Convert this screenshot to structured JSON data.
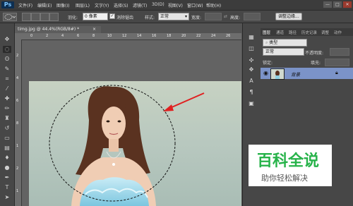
{
  "app": {
    "logo": "Ps"
  },
  "menu": [
    "文件(F)",
    "编辑(E)",
    "图像(I)",
    "图层(L)",
    "文字(Y)",
    "选择(S)",
    "滤镜(T)",
    "3D(D)",
    "视图(V)",
    "窗口(W)",
    "帮助(H)"
  ],
  "window_controls": {
    "minimize": "—",
    "maximize": "□",
    "close": "✕"
  },
  "options": {
    "feather_label": "羽化:",
    "feather_value": "0 像素",
    "antialias_label": "消除锯齿",
    "antialias_checked": "✓",
    "style_label": "样式:",
    "style_value": "正常",
    "width_label": "宽度:",
    "height_label": "高度:",
    "refine_button": "调整边缘..."
  },
  "document": {
    "tab_title": "timg.jpg @ 44.4%(RGB/8#) *",
    "tab_close": "×"
  },
  "ruler_numbers": [
    "0",
    "2",
    "4",
    "6",
    "8",
    "10",
    "12",
    "14",
    "16",
    "18",
    "20",
    "22",
    "24",
    "26"
  ],
  "ruler_left_numbers": [
    "2",
    "4",
    "6",
    "8",
    "1",
    "2",
    "1"
  ],
  "panel": {
    "tabs": [
      "图层",
      "通道",
      "路径",
      "历史记录",
      "调整",
      "动作"
    ],
    "filter_label": "类型",
    "blend_mode": "正常",
    "opacity_label": "不透明度:",
    "lock_label": "锁定:",
    "fill_label": "填充:",
    "layer_name": "背景"
  },
  "watermark": {
    "title": "百科全说",
    "subtitle": "助你轻松解决"
  },
  "colors": {
    "accent_layer": "#7b93c8",
    "watermark_green": "#27b34a",
    "arrow_red": "#e02020"
  }
}
